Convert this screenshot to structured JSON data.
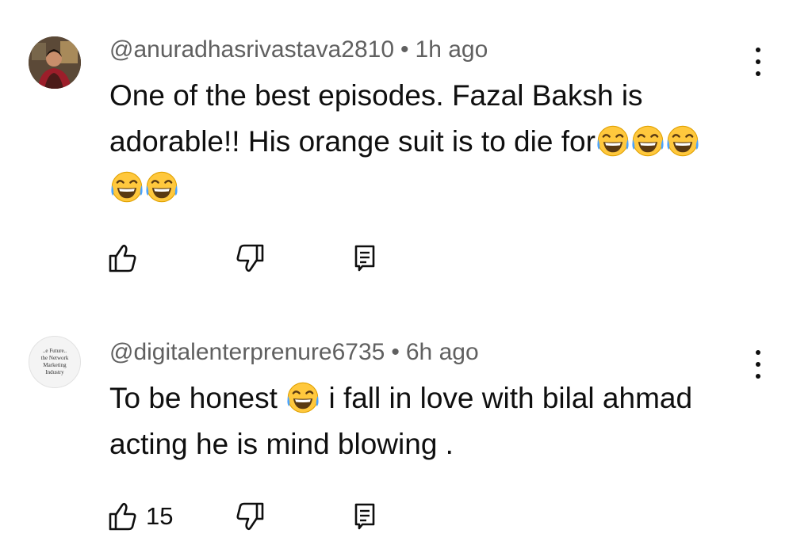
{
  "comments": [
    {
      "author": "@anuradhasrivastava2810",
      "separator": "•",
      "time": "1h ago",
      "text_line1": "One of the best episodes. Fazal Baksh is",
      "text_line2": "adorable!! His orange suit is to die for",
      "emoji_name": "face-with-tears-of-joy",
      "like_count": ""
    },
    {
      "author": "@digitalenterprenure6735",
      "separator": "•",
      "time": "6h ago",
      "text_part1": "To be honest ",
      "text_part2": " i fall in love with bilal ahmad",
      "text_line2": "acting he is mind blowing .",
      "avatar_lines": [
        "..e Future..",
        "the Network",
        "Marketing",
        "Industry"
      ],
      "like_count": "15"
    }
  ],
  "icons": {
    "like": "thumbs-up-outline-icon",
    "dislike": "thumbs-down-outline-icon",
    "reply": "reply-comment-icon",
    "more": "more-vertical-icon"
  }
}
